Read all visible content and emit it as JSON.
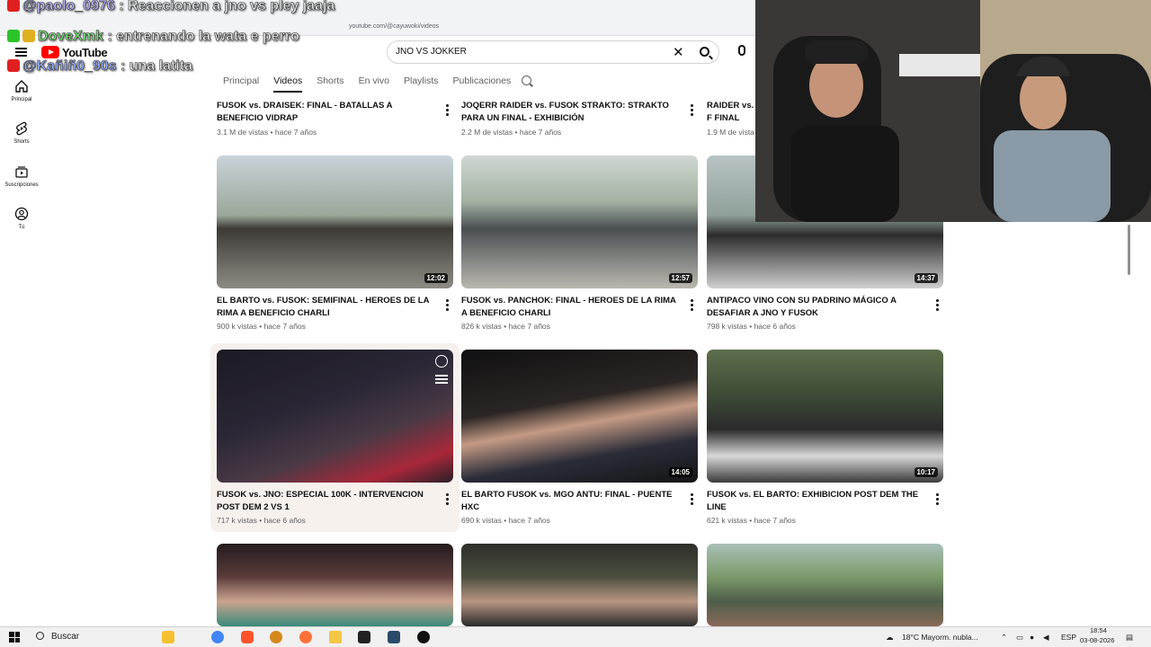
{
  "browser": {
    "url": "youtube.com/@cayuwoki/videos"
  },
  "youtube": {
    "logo_text": "YouTube",
    "search_value": "JNO VS JOKKER",
    "sidebar": [
      {
        "label": "Principal",
        "icon": "home-icon"
      },
      {
        "label": "Shorts",
        "icon": "shorts-icon"
      },
      {
        "label": "Suscripciones",
        "icon": "subscriptions-icon"
      },
      {
        "label": "Tú",
        "icon": "you-icon"
      }
    ],
    "tabs": [
      {
        "label": "Principal",
        "active": false
      },
      {
        "label": "Videos",
        "active": true
      },
      {
        "label": "Shorts",
        "active": false
      },
      {
        "label": "En vivo",
        "active": false
      },
      {
        "label": "Playlists",
        "active": false
      },
      {
        "label": "Publicaciones",
        "active": false
      }
    ]
  },
  "videos_top_row": [
    {
      "title": "FUSOK vs. DRAISEK: FINAL - BATALLAS A BENEFICIO VIDRAP",
      "meta": "3.1 M de vistas • hace 7 años"
    },
    {
      "title": "JOQERR RAIDER vs. FUSOK STRAKTO: STRAKTO PARA UN FINAL - EXHIBICIÓN",
      "meta": "2.2 M de vistas • hace 7 años"
    },
    {
      "title": "RAIDER vs. F FINAL",
      "meta": "1.9 M de vista"
    }
  ],
  "videos": [
    {
      "title": "EL BARTO vs. FUSOK: SEMIFINAL - HEROES DE LA RIMA A BENEFICIO CHARLI",
      "meta": "900 k vistas • hace 7 años",
      "duration": "12:02",
      "thumb_color": "#7a8a7e"
    },
    {
      "title": "FUSOK vs. PANCHOK: FINAL - HEROES DE LA RIMA A BENEFICIO CHARLI",
      "meta": "826 k vistas • hace 7 años",
      "duration": "12:57",
      "thumb_color": "#6f7c70"
    },
    {
      "title": "ANTIPACO VINO CON SU PADRINO MÁGICO A DESAFIAR A JNO Y FUSOK",
      "meta": "798 k vistas • hace 6 años",
      "duration": "14:37",
      "thumb_color": "#8a9aa0"
    },
    {
      "title": "FUSOK vs. JNO: ESPECIAL 100K - INTERVENCION POST DEM 2 VS 1",
      "meta": "717 k vistas • hace 6 años",
      "duration": "",
      "thumb_color": "#2a2530"
    },
    {
      "title": "EL BARTO FUSOK vs. MGO ANTU: FINAL - PUENTE HXC",
      "meta": "690 k vistas • hace 7 años",
      "duration": "14:05",
      "thumb_color": "#2e2b2a"
    },
    {
      "title": "FUSOK vs. EL BARTO: EXHIBICION POST DEM THE LINE",
      "meta": "621 k vistas • hace 7 años",
      "duration": "10:17",
      "thumb_color": "#3f4a3a"
    }
  ],
  "videos_bottom_row_colors": [
    "#3b2c2a",
    "#3a3a33",
    "#6a7b58"
  ],
  "chat": [
    {
      "user": "@paolo_0976",
      "message": "Reaccionen a jno vs pley jaaja"
    },
    {
      "user": "DoveXmk",
      "message": "entrenando la wata e perro"
    },
    {
      "user": "@Kañiñ0_90s",
      "message": "una latita"
    }
  ],
  "taskbar": {
    "search_label": "Buscar",
    "weather": "18°C  Mayorm. nubla...",
    "language": "ESP",
    "time": "18:54",
    "date": "03-08-2026"
  }
}
